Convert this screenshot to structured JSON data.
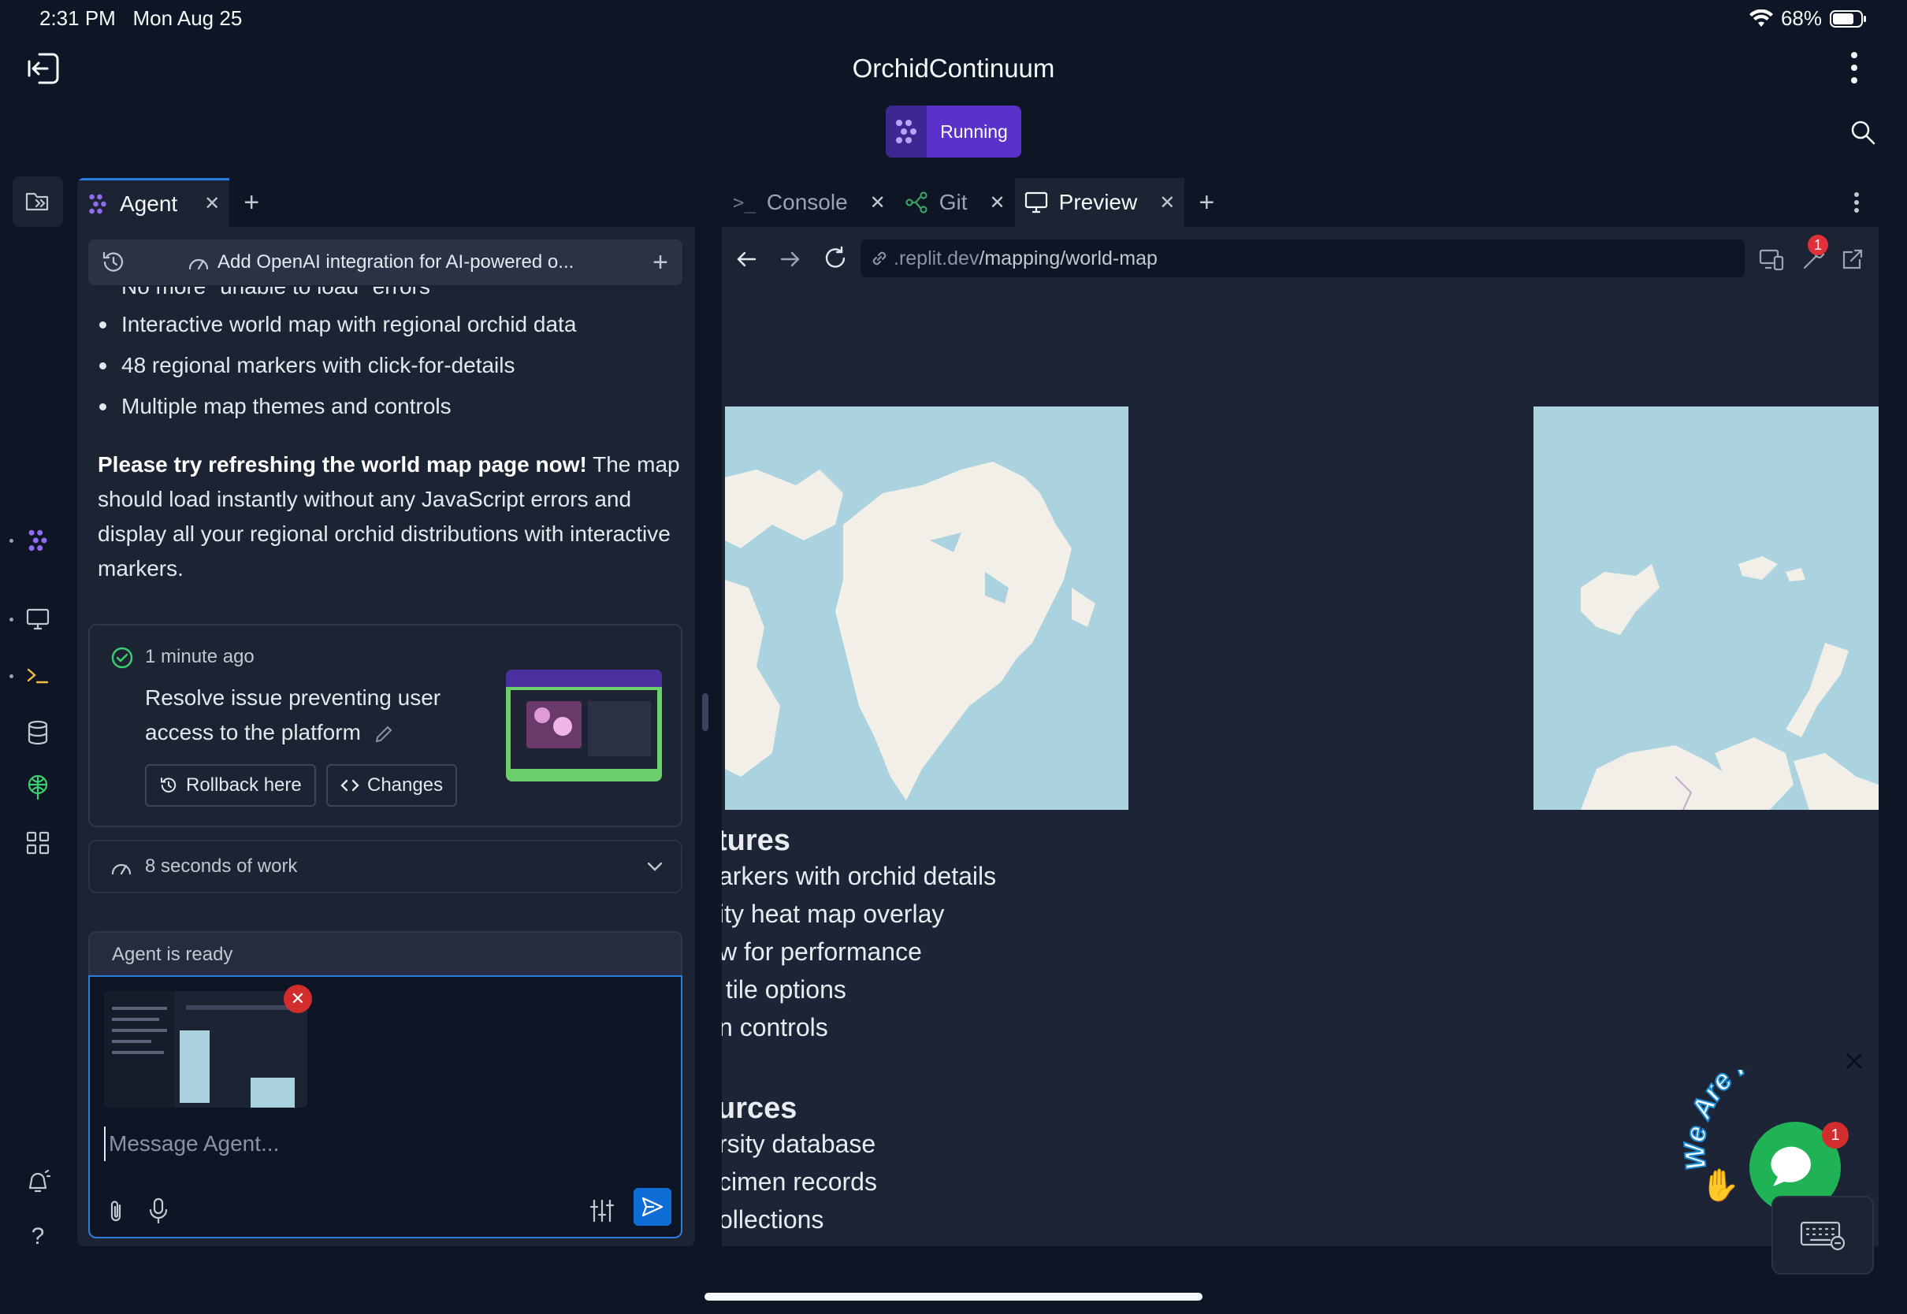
{
  "status_bar": {
    "time": "2:31 PM",
    "date": "Mon Aug 25",
    "battery": "68%"
  },
  "header": {
    "title": "OrchidContinuum",
    "run_status": "Running"
  },
  "agent_panel": {
    "tab_label": "Agent",
    "task_title": "Add OpenAI integration for AI-powered o...",
    "messages": {
      "partial_line": "No more \"unable to load\" errors",
      "bullets": [
        "Interactive world map with regional orchid data",
        "48 regional markers with click-for-details",
        "Multiple map themes and controls"
      ],
      "para_bold": "Please try refreshing the world map page now!",
      "para_rest": " The map should load instantly without any JavaScript errors and display all your regional orchid distributions with interactive markers."
    },
    "checkpoint": {
      "time": "1 minute ago",
      "description": "Resolve issue preventing user access to the platform",
      "rollback_label": "Rollback here",
      "changes_label": "Changes"
    },
    "work_summary": "8 seconds of work",
    "input": {
      "status": "Agent is ready",
      "placeholder": "Message Agent..."
    }
  },
  "right_panel": {
    "tabs": [
      "Console",
      "Git",
      "Preview"
    ],
    "url_domain": ".replit.dev",
    "url_path": "/mapping/world-map",
    "notification_count": "1",
    "preview": {
      "features_title": "tures",
      "features": [
        "arkers with orchid details",
        "ity heat map overlay",
        "w for performance",
        " tile options",
        "n controls"
      ],
      "sources_title": "urces",
      "sources": [
        "rsity database",
        "cimen records",
        "ollections"
      ]
    },
    "chat_widget": {
      "text": "We Are Here!",
      "badge": "1"
    }
  },
  "colors": {
    "background": "#0e1525",
    "panel": "#1c2333",
    "accent": "#5a31c9",
    "focus": "#2b7ce0",
    "map_water": "#aad3df",
    "map_land": "#f2efe9",
    "widget_green": "#1fb356"
  }
}
